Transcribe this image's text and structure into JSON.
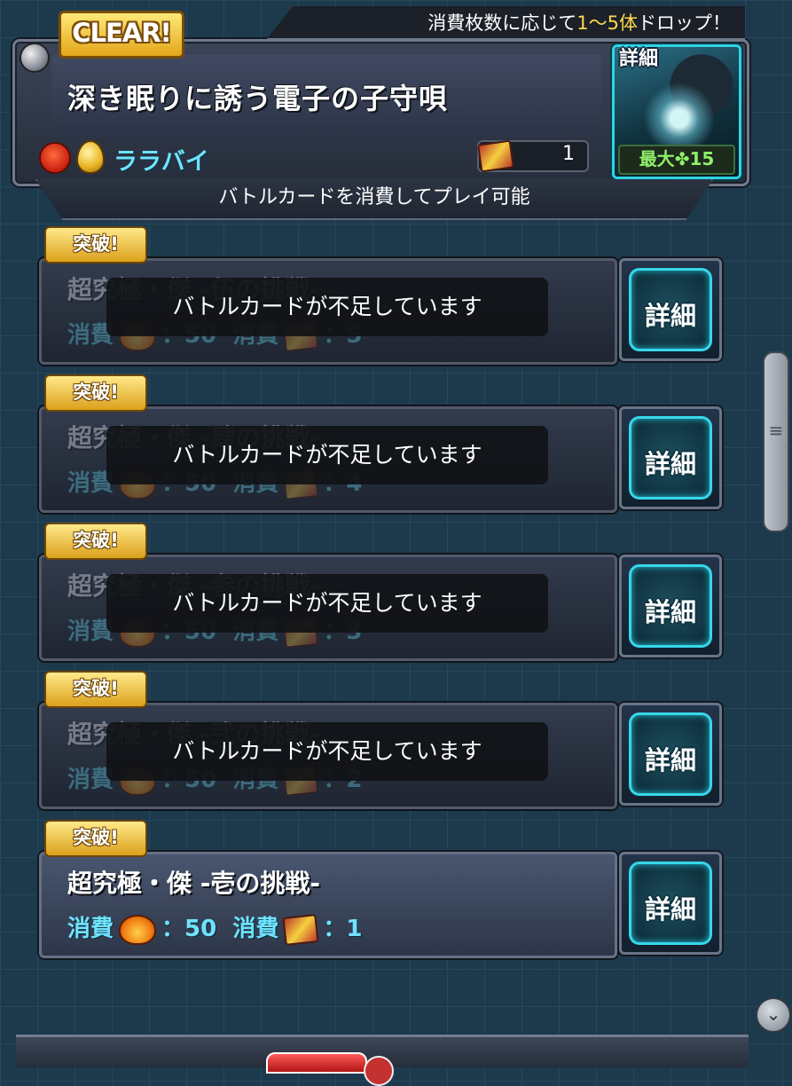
{
  "header": {
    "clear_badge": "CLEAR!",
    "drop_banner_prefix": "消費枚数に応じて",
    "drop_banner_highlight": "1〜5体",
    "drop_banner_suffix": "ドロップ！",
    "quest_title": "深き眠りに誘う電子の子守唄",
    "element_name": "ララバイ",
    "card_count": "1",
    "portrait_label": "詳細",
    "max_label": "最大",
    "max_value": "15",
    "sub_info": "バトルカードを消費してプレイ可能"
  },
  "quests": [
    {
      "badge": "突破!",
      "name": "超究極・傑 -伍の挑戦-",
      "cost_label_1": "消費",
      "stamina_value": "：50",
      "cost_label_2": "消費",
      "card_value": "：5",
      "locked": true,
      "toast": "バトルカードが不足しています",
      "detail_label": "詳細"
    },
    {
      "badge": "突破!",
      "name": "超究極・傑 -肆の挑戦-",
      "cost_label_1": "消費",
      "stamina_value": "：50",
      "cost_label_2": "消費",
      "card_value": "：4",
      "locked": true,
      "toast": "バトルカードが不足しています",
      "detail_label": "詳細"
    },
    {
      "badge": "突破!",
      "name": "超究極・傑 -参の挑戦-",
      "cost_label_1": "消費",
      "stamina_value": "：50",
      "cost_label_2": "消費",
      "card_value": "：3",
      "locked": true,
      "toast": "バトルカードが不足しています",
      "detail_label": "詳細"
    },
    {
      "badge": "突破!",
      "name": "超究極・傑 -弐の挑戦-",
      "cost_label_1": "消費",
      "stamina_value": "：50",
      "cost_label_2": "消費",
      "card_value": "：2",
      "locked": true,
      "toast": "バトルカードが不足しています",
      "detail_label": "詳細"
    },
    {
      "badge": "突破!",
      "name": "超究極・傑 -壱の挑戦-",
      "cost_label_1": "消費",
      "stamina_value": "：50",
      "cost_label_2": "消費",
      "card_value": "：1",
      "locked": false,
      "toast": "",
      "detail_label": "詳細"
    }
  ],
  "icons": {
    "stamina_icon": "stamina-icon",
    "battle_card_icon": "battle-card-icon",
    "scroll_down_icon": "chevron-down-icon"
  },
  "colors": {
    "accent_cyan": "#37d7ea",
    "badge_gold": "#dba11c",
    "highlight_yellow": "#ffd94a",
    "max_green": "#8ff06a"
  }
}
